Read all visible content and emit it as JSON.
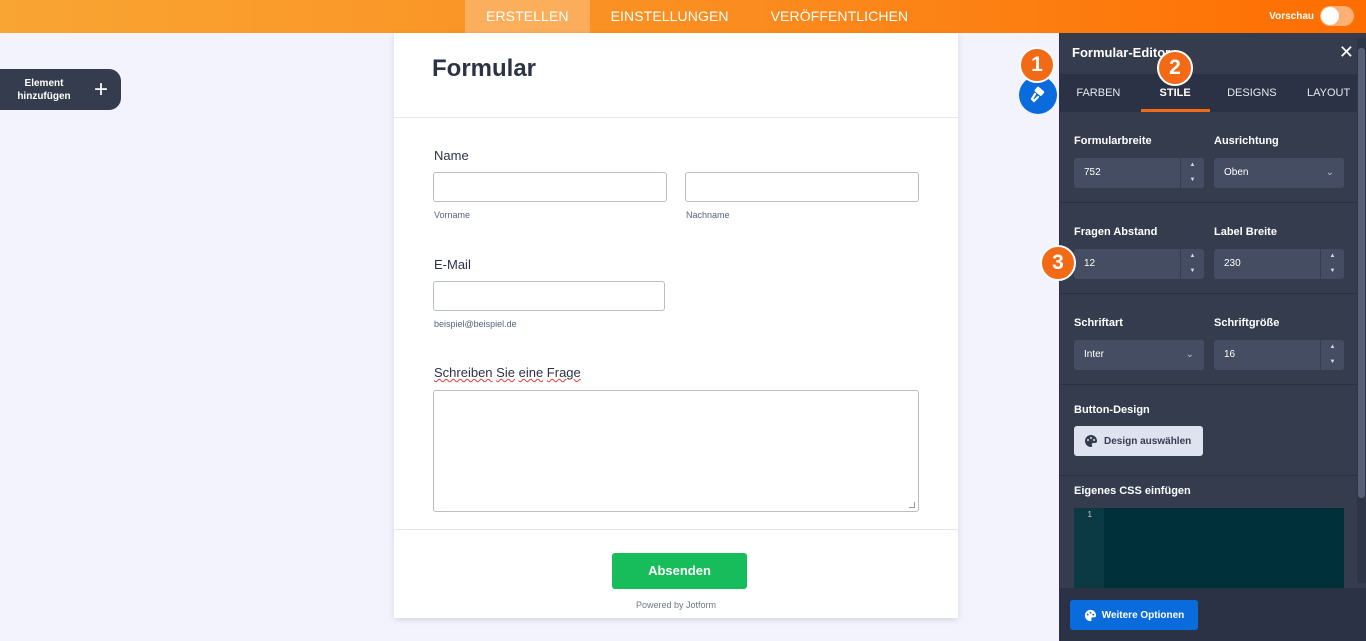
{
  "topbar": {
    "tabs": [
      {
        "label": "ERSTELLEN",
        "active": true
      },
      {
        "label": "EINSTELLUNGEN",
        "active": false
      },
      {
        "label": "VERÖFFENTLICHEN",
        "active": false
      }
    ],
    "preview_label": "Vorschau",
    "preview_on": false
  },
  "add_element": {
    "label": "Element hinzufügen",
    "icon": "plus-icon"
  },
  "form": {
    "title": "Formular",
    "name_label": "Name",
    "first_name_sublabel": "Vorname",
    "last_name_sublabel": "Nachname",
    "email_label": "E-Mail",
    "email_sublabel": "beispiel@beispiel.de",
    "question_label_words": [
      "Schreiben",
      "Sie",
      "eine",
      "Frage"
    ],
    "submit_label": "Absenden",
    "powered_by": "Powered by Jotform"
  },
  "markers": [
    "1",
    "2",
    "3"
  ],
  "panel": {
    "title": "Formular-Editor",
    "tabs": [
      {
        "label": "FARBEN",
        "active": false
      },
      {
        "label": "STILE",
        "active": true
      },
      {
        "label": "DESIGNS",
        "active": false
      },
      {
        "label": "LAYOUT",
        "active": false
      }
    ],
    "form_width_label": "Formularbreite",
    "form_width_value": "752",
    "alignment_label": "Ausrichtung",
    "alignment_value": "Oben",
    "question_spacing_label": "Fragen Abstand",
    "question_spacing_value": "12",
    "label_width_label": "Label Breite",
    "label_width_value": "230",
    "font_label": "Schriftart",
    "font_value": "Inter",
    "font_size_label": "Schriftgröße",
    "font_size_value": "16",
    "button_design_label": "Button-Design",
    "button_design_action": "Design auswählen",
    "custom_css_label": "Eigenes CSS einfügen",
    "css_line_number": "1",
    "more_options_label": "Weitere Optionen"
  },
  "colors": {
    "accent_orange": "#f26a15",
    "primary_blue": "#0a6bdc",
    "submit_green": "#18bd5b",
    "panel_bg": "#343c4e"
  }
}
